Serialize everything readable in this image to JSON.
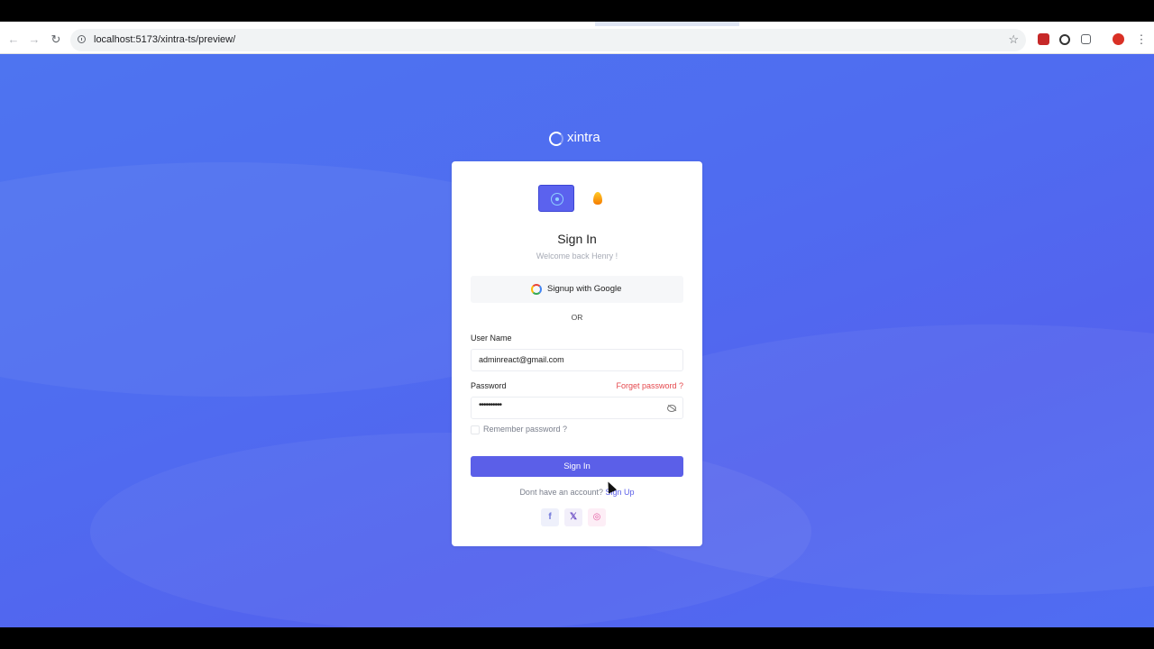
{
  "browser": {
    "url": "localhost:5173/xintra-ts/preview/",
    "back_icon": "←",
    "forward_icon": "→",
    "reload_icon": "↻",
    "star_icon": "☆",
    "menu_icon": "⋮"
  },
  "brand": {
    "name": "xintra"
  },
  "auth": {
    "title": "Sign In",
    "subtitle": "Welcome back Henry !",
    "google_label": "Signup with Google",
    "or_text": "OR",
    "username_label": "User Name",
    "username_value": "adminreact@gmail.com",
    "password_label": "Password",
    "forgot_label": "Forget password ?",
    "password_mask": "••••••••••",
    "remember_label": "Remember password ?",
    "signin_label": "Sign In",
    "signup_prefix": "Dont have an account? ",
    "signup_link": "Sign Up"
  },
  "social": {
    "facebook": "f",
    "x": "𝕏",
    "instagram": "◎"
  },
  "colors": {
    "primary": "#5b5fe8",
    "danger": "#e5484d",
    "background": "#4f6cf0"
  }
}
